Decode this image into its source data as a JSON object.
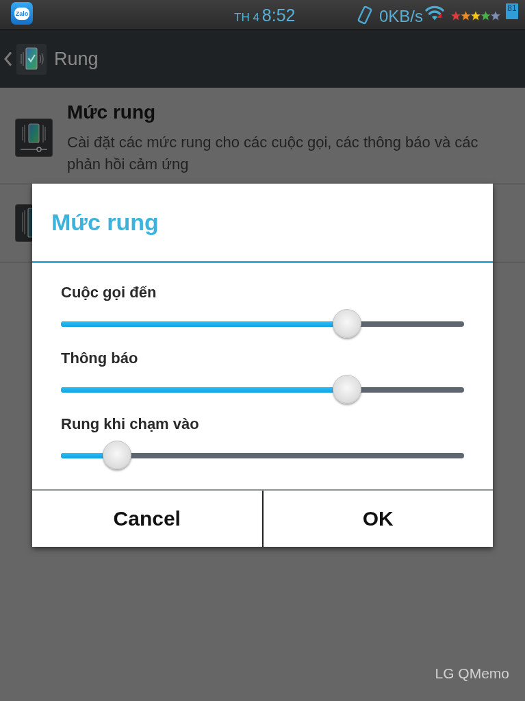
{
  "status_bar": {
    "app_icon_label": "Zalo",
    "day": "TH 4",
    "time": "8:52",
    "network_speed": "0KB/s",
    "battery": "81"
  },
  "header": {
    "title": "Rung"
  },
  "settings_list": [
    {
      "title": "Mức rung",
      "description": "Cài đặt các mức rung cho các cuộc gọi, các thông báo và các phản hồi cảm ứng"
    }
  ],
  "dialog": {
    "title": "Mức rung",
    "sliders": [
      {
        "label": "Cuộc gọi đến",
        "level": 0.71
      },
      {
        "label": "Thông báo",
        "level": 0.71
      },
      {
        "label": "Rung khi chạm vào",
        "level": 0.14
      }
    ],
    "buttons": [
      {
        "label": "Cancel"
      },
      {
        "label": "OK"
      }
    ]
  },
  "footer_label": "LG QMemo"
}
